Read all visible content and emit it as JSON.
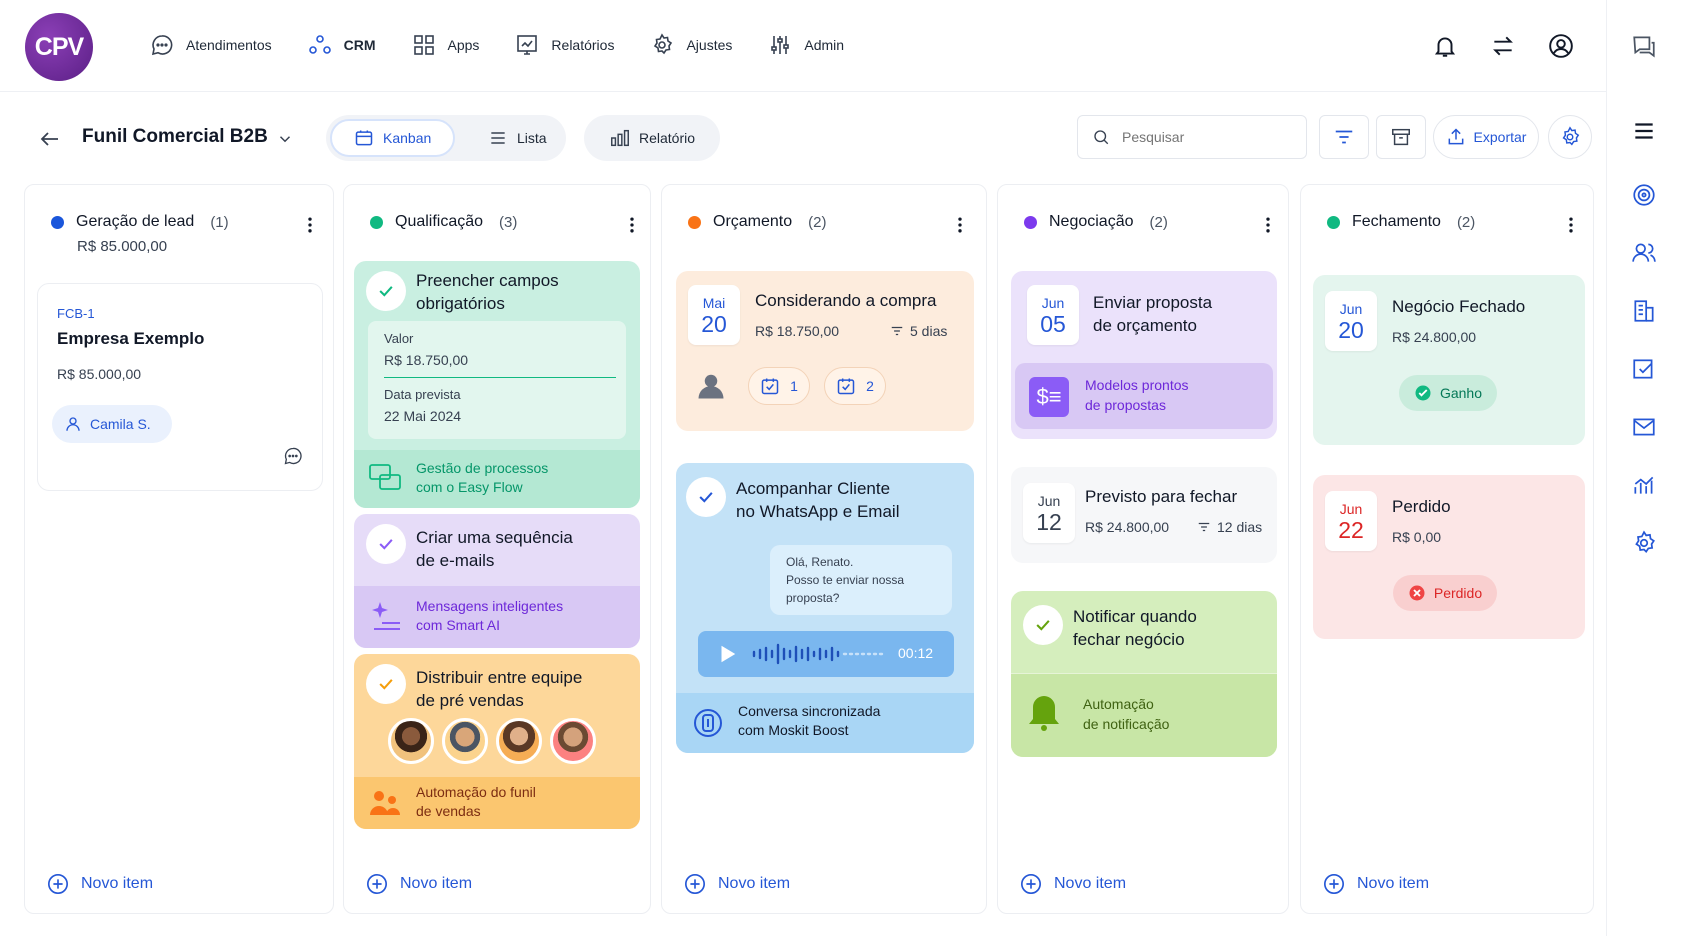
{
  "logo": "CPV",
  "nav": [
    {
      "label": "Atendimentos",
      "icon": "chat-icon"
    },
    {
      "label": "CRM",
      "icon": "crm-icon"
    },
    {
      "label": "Apps",
      "icon": "apps-grid-icon"
    },
    {
      "label": "Relatórios",
      "icon": "reports-icon"
    },
    {
      "label": "Ajustes",
      "icon": "gear-icon"
    },
    {
      "label": "Admin",
      "icon": "sliders-icon"
    }
  ],
  "toolbar": {
    "board_title": "Funil Comercial B2B",
    "view_kanban": "Kanban",
    "view_lista": "Lista",
    "report": "Relatório",
    "search_placeholder": "Pesquisar",
    "export": "Exportar"
  },
  "columns": [
    {
      "title": "Geração de lead",
      "count": "(1)",
      "total": "R$ 85.000,00",
      "color": "#1a56db",
      "novo": "Novo item"
    },
    {
      "title": "Qualificação",
      "count": "(3)",
      "color": "#10b981",
      "novo": "Novo item"
    },
    {
      "title": "Orçamento",
      "count": "(2)",
      "color": "#f97316",
      "novo": "Novo item"
    },
    {
      "title": "Negociação",
      "count": "(2)",
      "color": "#7c3aed",
      "novo": "Novo item"
    },
    {
      "title": "Fechamento",
      "count": "(2)",
      "color": "#10b981",
      "novo": "Novo item"
    }
  ],
  "lead_card": {
    "code": "FCB-1",
    "company": "Empresa Exemplo",
    "value": "R$ 85.000,00",
    "owner": "Camila S."
  },
  "qual_cards": [
    {
      "title_1": "Preencher campos",
      "title_2": "obrigatórios",
      "valor_label": "Valor",
      "valor": "R$ 18.750,00",
      "data_label": "Data prevista",
      "data": "22 Mai 2024",
      "footer_1": "Gestão de processos",
      "footer_2": "com o Easy Flow"
    },
    {
      "title_1": "Criar uma sequência",
      "title_2": "de e-mails",
      "footer_1": "Mensagens inteligentes",
      "footer_2": "com Smart AI"
    },
    {
      "title_1": "Distribuir entre equipe",
      "title_2": "de pré vendas",
      "footer_1": "Automação do funil",
      "footer_2": "de vendas"
    }
  ],
  "orc_cards": [
    {
      "month": "Mai",
      "day": "20",
      "title": "Considerando a compra",
      "value": "R$ 18.750,00",
      "days": "5 dias",
      "task1": "1",
      "task2": "2"
    },
    {
      "title_1": "Acompanhar Cliente",
      "title_2": "no WhatsApp e Email",
      "msg_1": "Olá, Renato.",
      "msg_2": "Posso te enviar nossa",
      "msg_3": "proposta?",
      "audio_time": "00:12",
      "footer_1": "Conversa sincronizada",
      "footer_2": "com Moskit Boost"
    }
  ],
  "neg_cards": [
    {
      "month": "Jun",
      "day": "05",
      "title_1": "Enviar proposta",
      "title_2": "de orçamento",
      "footer_1": "Modelos prontos",
      "footer_2": "de propostas"
    },
    {
      "month": "Jun",
      "day": "12",
      "title": "Previsto para fechar",
      "value": "R$ 24.800,00",
      "days": "12 dias"
    },
    {
      "title_1": "Notificar quando",
      "title_2": "fechar negócio",
      "footer_1": "Automação",
      "footer_2": "de notificação"
    }
  ],
  "fech_cards": [
    {
      "month": "Jun",
      "day": "20",
      "title": "Negócio Fechado",
      "value": "R$ 24.800,00",
      "status": "Ganho"
    },
    {
      "month": "Jun",
      "day": "22",
      "title": "Perdido",
      "value": "R$ 0,00",
      "status": "Perdido"
    }
  ]
}
